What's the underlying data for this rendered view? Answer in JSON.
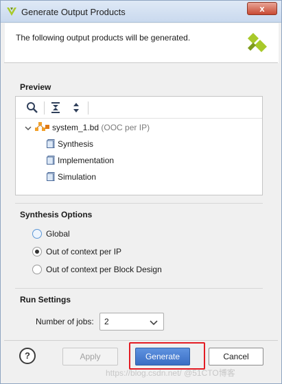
{
  "window": {
    "title": "Generate Output Products",
    "close_label": "x"
  },
  "header": {
    "description": "The following output products will be generated."
  },
  "preview": {
    "title": "Preview",
    "tree": {
      "root": {
        "name": "system_1.bd",
        "note": "(OOC per IP)"
      },
      "children": [
        "Synthesis",
        "Implementation",
        "Simulation"
      ]
    }
  },
  "synthesis_options": {
    "title": "Synthesis Options",
    "options": [
      {
        "label": "Global",
        "selected": false
      },
      {
        "label": "Out of context per IP",
        "selected": true
      },
      {
        "label": "Out of context per Block Design",
        "selected": false
      }
    ]
  },
  "run_settings": {
    "title": "Run Settings",
    "jobs_label": "Number of jobs:",
    "jobs_value": "2"
  },
  "buttons": {
    "help": "?",
    "apply": "Apply",
    "generate": "Generate",
    "cancel": "Cancel"
  },
  "watermark": "https://blog.csdn.net/  @51CTO博客",
  "colors": {
    "accent": "#3a6ec4",
    "highlight_border": "#e31b23",
    "logo_green": "#a8c92a"
  }
}
